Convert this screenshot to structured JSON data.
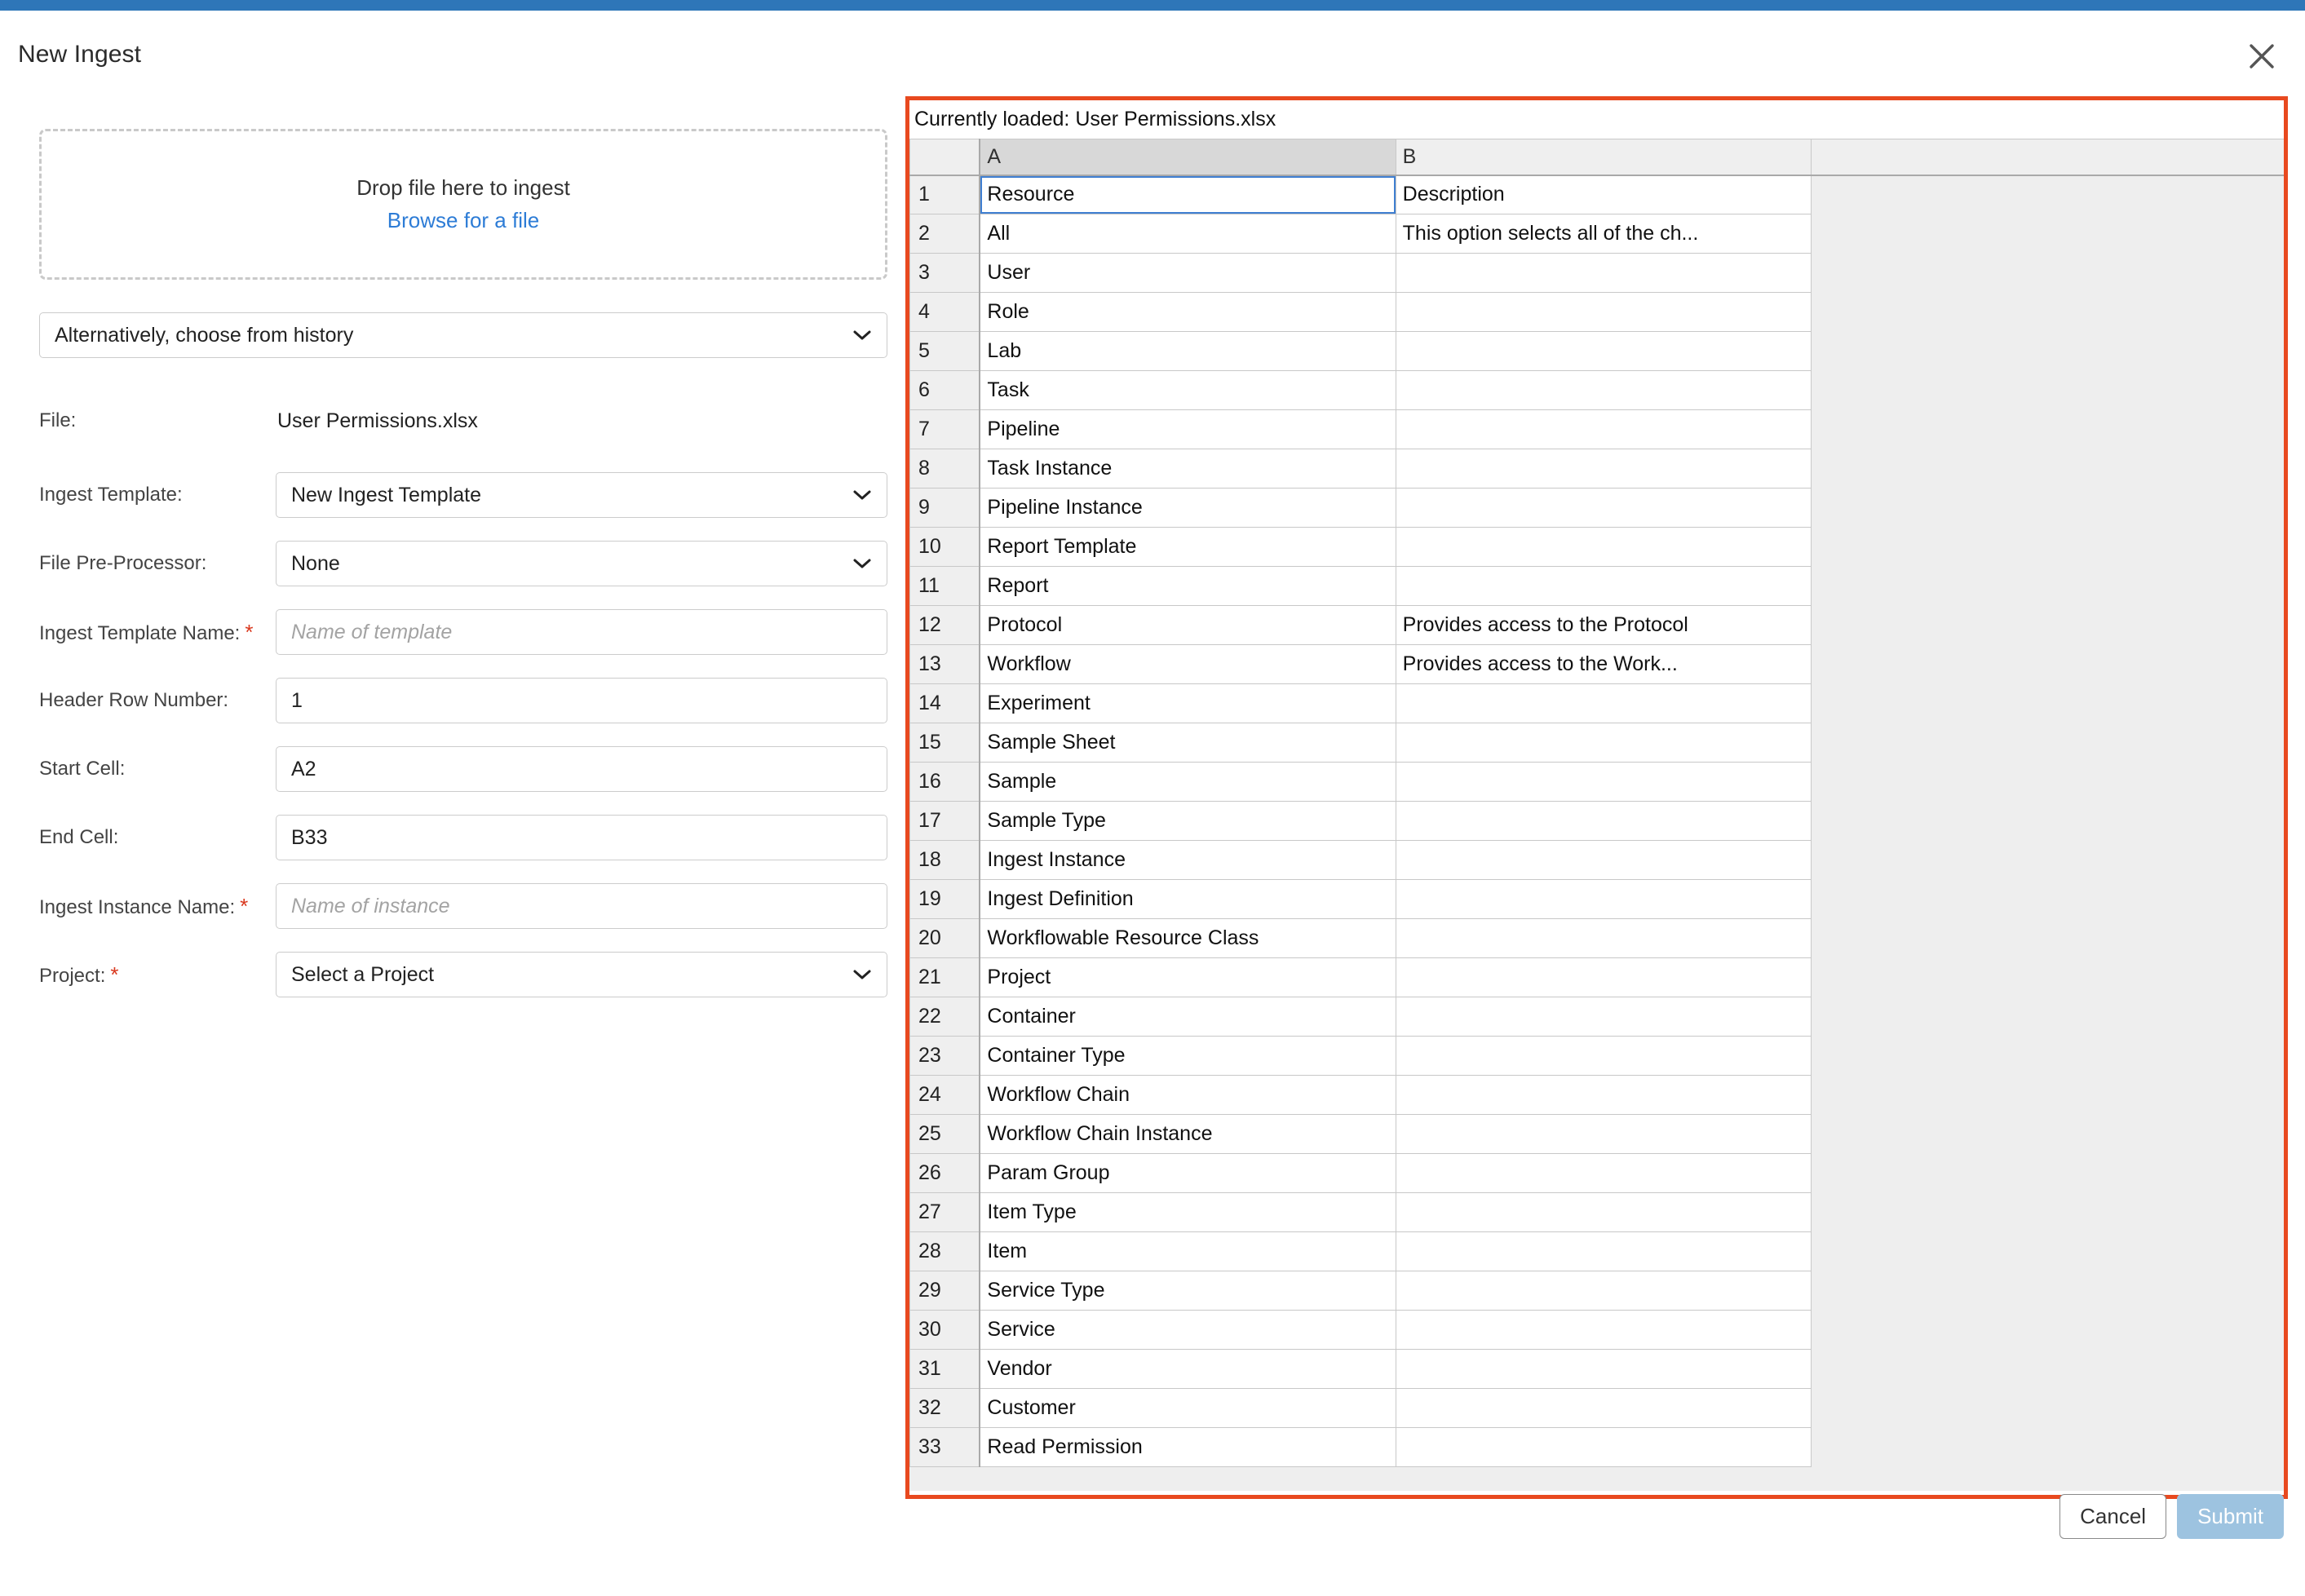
{
  "theme": {
    "accent_blue": "#2e76b8",
    "panel_border_orange": "#e8491f",
    "link_blue": "#2d7cd6",
    "required_red": "#d9381e",
    "submit_disabled_blue": "#9dc3e0",
    "cell_selection_blue": "#3f7fd1"
  },
  "dialog": {
    "title": "New Ingest",
    "close_label": "×"
  },
  "dropzone": {
    "prompt": "Drop file here to ingest",
    "browse_link": "Browse for a file"
  },
  "history": {
    "selected": "Alternatively, choose from history"
  },
  "form": {
    "file": {
      "label": "File:",
      "value": "User Permissions.xlsx"
    },
    "ingest_template": {
      "label": "Ingest Template:",
      "value": "New Ingest Template"
    },
    "file_preprocessor": {
      "label": "File Pre-Processor:",
      "value": "None"
    },
    "ingest_template_name": {
      "label": "Ingest Template Name:",
      "required": "*",
      "placeholder": "Name of template",
      "value": ""
    },
    "header_row_number": {
      "label": "Header Row Number:",
      "value": "1"
    },
    "start_cell": {
      "label": "Start Cell:",
      "value": "A2"
    },
    "end_cell": {
      "label": "End Cell:",
      "value": "B33"
    },
    "ingest_instance_name": {
      "label": "Ingest Instance Name:",
      "required": "*",
      "placeholder": "Name of instance",
      "value": ""
    },
    "project": {
      "label": "Project:",
      "required": "*",
      "value": "Select a Project"
    }
  },
  "sheet": {
    "loaded_label": "Currently loaded: User Permissions.xlsx",
    "columns": [
      "A",
      "B"
    ],
    "selected_column": "A",
    "active_cell": "A1",
    "rows": [
      {
        "n": "1",
        "a": "Resource",
        "b": "Description"
      },
      {
        "n": "2",
        "a": "All",
        "b": "This option selects all of the ch..."
      },
      {
        "n": "3",
        "a": "User",
        "b": ""
      },
      {
        "n": "4",
        "a": "Role",
        "b": ""
      },
      {
        "n": "5",
        "a": "Lab",
        "b": ""
      },
      {
        "n": "6",
        "a": "Task",
        "b": ""
      },
      {
        "n": "7",
        "a": "Pipeline",
        "b": ""
      },
      {
        "n": "8",
        "a": "Task Instance",
        "b": ""
      },
      {
        "n": "9",
        "a": "Pipeline Instance",
        "b": ""
      },
      {
        "n": "10",
        "a": "Report Template",
        "b": ""
      },
      {
        "n": "11",
        "a": "Report",
        "b": ""
      },
      {
        "n": "12",
        "a": "Protocol",
        "b": "Provides access to the Protocol"
      },
      {
        "n": "13",
        "a": "Workflow",
        "b": "Provides access to the Work..."
      },
      {
        "n": "14",
        "a": "Experiment",
        "b": ""
      },
      {
        "n": "15",
        "a": "Sample Sheet",
        "b": ""
      },
      {
        "n": "16",
        "a": "Sample",
        "b": ""
      },
      {
        "n": "17",
        "a": "Sample Type",
        "b": ""
      },
      {
        "n": "18",
        "a": "Ingest Instance",
        "b": ""
      },
      {
        "n": "19",
        "a": "Ingest Definition",
        "b": ""
      },
      {
        "n": "20",
        "a": "Workflowable Resource Class",
        "b": ""
      },
      {
        "n": "21",
        "a": "Project",
        "b": ""
      },
      {
        "n": "22",
        "a": "Container",
        "b": ""
      },
      {
        "n": "23",
        "a": "Container Type",
        "b": ""
      },
      {
        "n": "24",
        "a": "Workflow Chain",
        "b": ""
      },
      {
        "n": "25",
        "a": "Workflow Chain Instance",
        "b": ""
      },
      {
        "n": "26",
        "a": "Param Group",
        "b": ""
      },
      {
        "n": "27",
        "a": "Item Type",
        "b": ""
      },
      {
        "n": "28",
        "a": "Item",
        "b": ""
      },
      {
        "n": "29",
        "a": "Service Type",
        "b": ""
      },
      {
        "n": "30",
        "a": "Service",
        "b": ""
      },
      {
        "n": "31",
        "a": "Vendor",
        "b": ""
      },
      {
        "n": "32",
        "a": "Customer",
        "b": ""
      },
      {
        "n": "33",
        "a": "Read Permission",
        "b": ""
      }
    ]
  },
  "footer": {
    "cancel_label": "Cancel",
    "submit_label": "Submit"
  }
}
